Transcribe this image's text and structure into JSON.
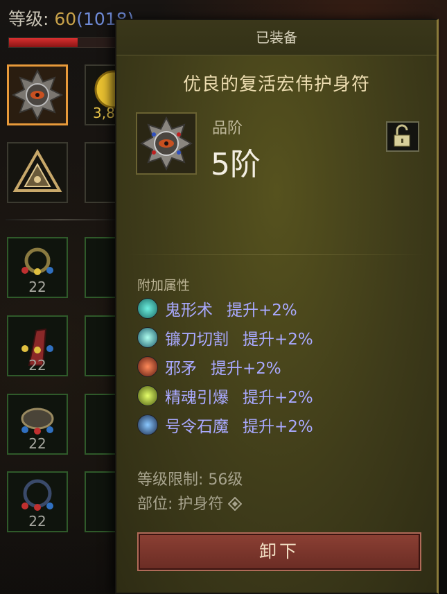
{
  "player": {
    "level_label": "等级:",
    "level_value": "60",
    "paragon": "(1018)",
    "xp_fraction": 0.62
  },
  "inventory": {
    "slot_levels": [
      "22",
      "22",
      "22",
      "22"
    ],
    "gold_text": "3,8"
  },
  "tooltip": {
    "header": "已装备",
    "item_name": "优良的复活宏伟护身符",
    "grade_label": "品阶",
    "grade_value": "5阶",
    "lock_icon": "unlock-icon",
    "attributes_title": "附加属性",
    "attributes": [
      {
        "skill": "鬼形术",
        "bonus": "提升+2%",
        "icon": "ghost-skill-icon",
        "color": "#2fa8a0"
      },
      {
        "skill": "镰刀切割",
        "bonus": "提升+2%",
        "icon": "scythe-skill-icon",
        "color": "#3a9a9a"
      },
      {
        "skill": "邪矛",
        "bonus": "提升+2%",
        "icon": "spear-skill-icon",
        "color": "#a03a22"
      },
      {
        "skill": "精魂引爆",
        "bonus": "提升+2%",
        "icon": "explode-skill-icon",
        "color": "#8aa620"
      },
      {
        "skill": "号令石魔",
        "bonus": "提升+2%",
        "icon": "golem-skill-icon",
        "color": "#2a4a7a"
      }
    ],
    "level_requirement": "等级限制:  56级",
    "slot_text": "部位: 护身符",
    "unequip_label": "卸下"
  },
  "colors": {
    "attribute_text": "#a9a9ff",
    "item_name": "#ecdcb0",
    "button": "#7a362c"
  }
}
